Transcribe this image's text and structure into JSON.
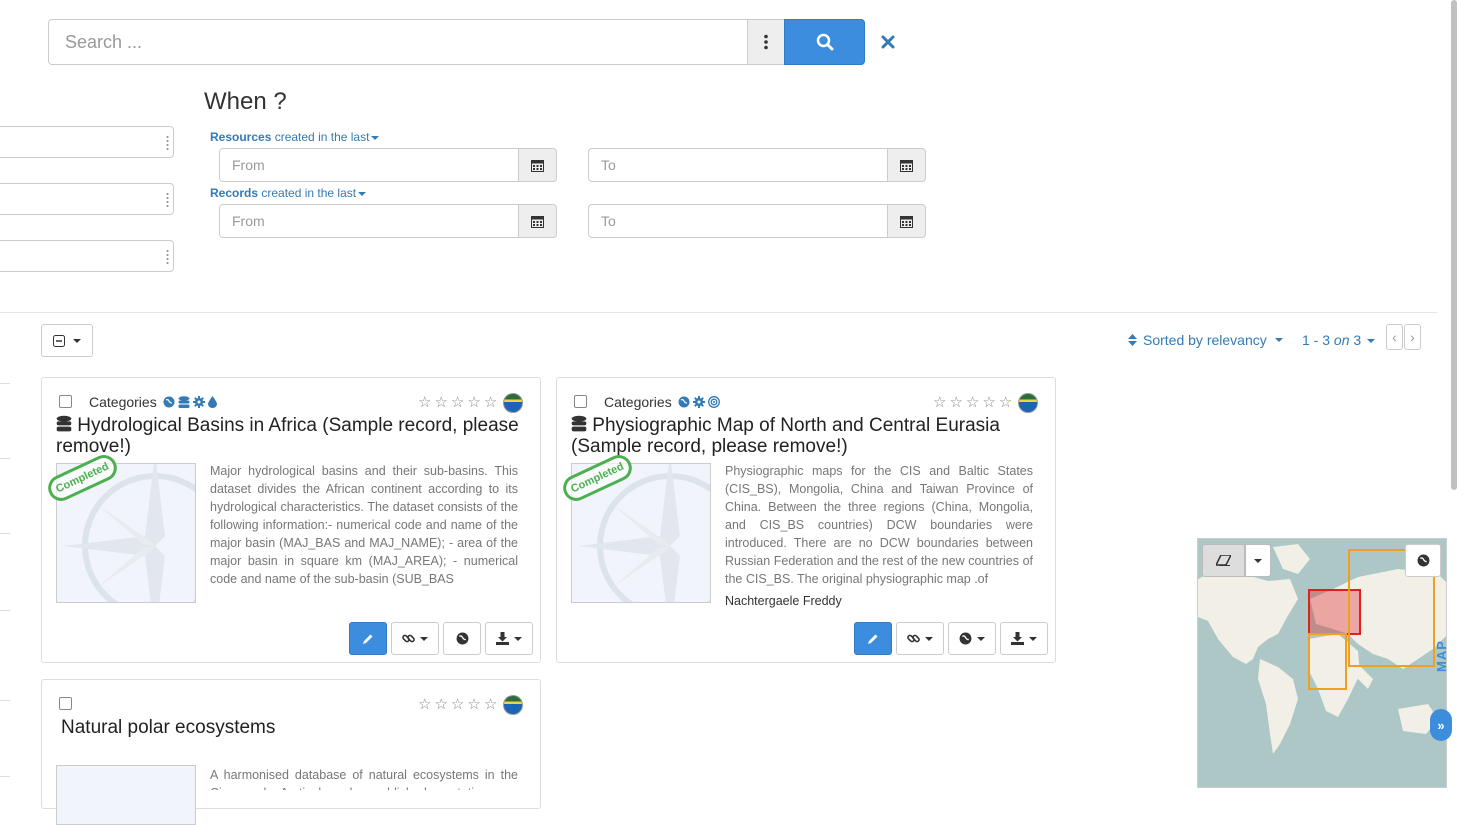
{
  "search": {
    "placeholder": "Search ..."
  },
  "when": {
    "title": "When ?",
    "resources_label_bold": "Resources",
    "resources_label_rest": " created in the last",
    "records_label_bold": "Records",
    "records_label_rest": " created in the last",
    "from_placeholder": "From",
    "to_placeholder": "To"
  },
  "results": {
    "sort_label": "Sorted by relevancy",
    "pager_range": "1 - 3",
    "pager_on": "on",
    "pager_total": "3"
  },
  "records": [
    {
      "categories_label": "Categories",
      "title": "Hydrological Basins in Africa (Sample record, please remove!)",
      "stamp": "Completed",
      "abstract": "Major hydrological basins and their sub-basins. This dataset divides the African continent according to its hydrological characteristics. The dataset consists of the following information:- numerical code and name of the major basin (MAJ_BAS and MAJ_NAME); - area of the major basin in square km (MAJ_AREA); - numerical code and name of the sub-basin (SUB_BAS"
    },
    {
      "categories_label": "Categories",
      "title": "Physiographic Map of North and Central Eurasia (Sample record, please remove!)",
      "stamp": "Completed",
      "abstract": "Physiographic maps for the CIS and Baltic States (CIS_BS), Mongolia, China and Taiwan Province of China. Between the three regions (China, Mongolia, and CIS_BS countries) DCW boundaries were introduced. There are no DCW boundaries between Russian Federation and the rest of the new countries of the CIS_BS. The original physiographic map .of",
      "author": "Nachtergaele Freddy"
    },
    {
      "title": "Natural polar ecosystems",
      "abstract": "A harmonised database of natural ecosystems in the Circumpolar Arctic, based on published vegetation"
    }
  ],
  "map": {
    "label": "MAP"
  },
  "colors": {
    "accent": "#3c8dde",
    "link": "#337ab7",
    "stamp": "#4caf50",
    "bbox_selected": "#e02020",
    "bbox_other": "#f0a020"
  }
}
